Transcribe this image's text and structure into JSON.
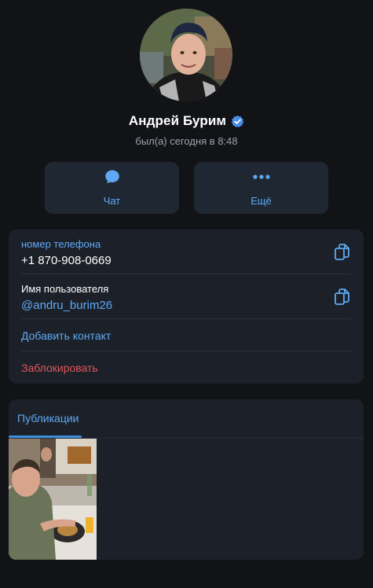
{
  "profile": {
    "name": "Андрей Бурим",
    "verified_icon": "verified-badge-icon",
    "status": "был(а) сегодня в 8:48"
  },
  "actions": {
    "chat_label": "Чат",
    "more_label": "Ещё"
  },
  "info": {
    "phone_label": "номер телефона",
    "phone_value": "+1 870-908-0669",
    "username_label": "Имя пользователя",
    "username_value": "@andru_burim26",
    "add_contact": "Добавить контакт",
    "block": "Заблокировать"
  },
  "publications": {
    "tab_label": "Публикации"
  },
  "colors": {
    "background": "#121316",
    "card": "#1c2129",
    "accent": "#5fa9f4",
    "danger": "#e0545a"
  }
}
